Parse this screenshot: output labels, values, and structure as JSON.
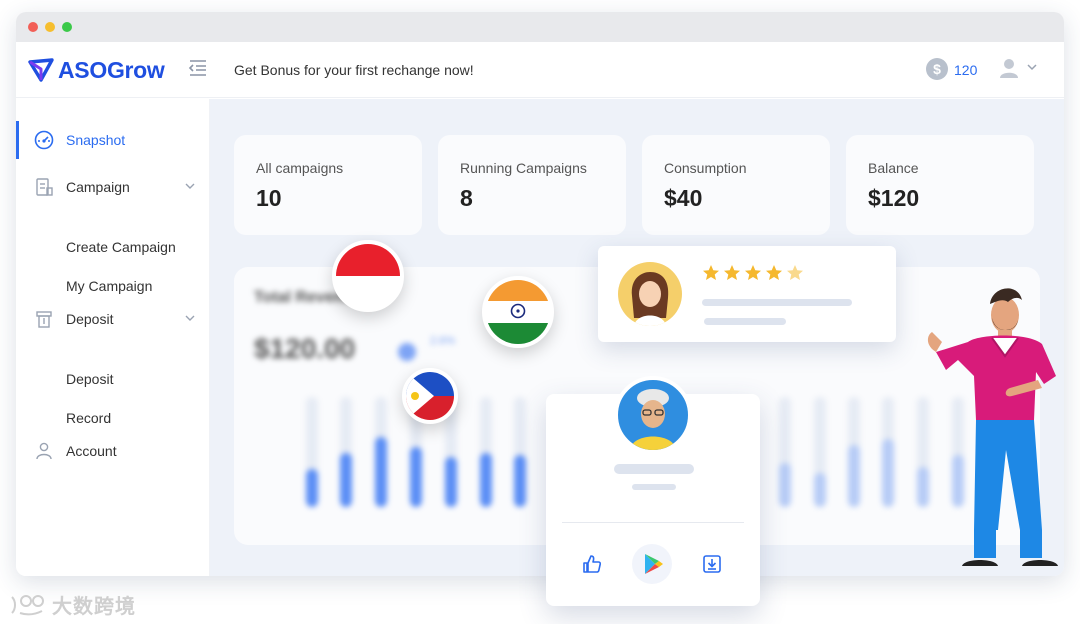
{
  "app": {
    "logo_text": "ASOGrow"
  },
  "header": {
    "bonus_text": "Get Bonus for your first rechange now!",
    "coin_symbol": "$",
    "balance": "120"
  },
  "sidebar": {
    "snapshot": "Snapshot",
    "campaign": "Campaign",
    "create_campaign": "Create Campaign",
    "my_campaign": "My Campaign",
    "deposit": "Deposit",
    "deposit_sub": "Deposit",
    "record": "Record",
    "account": "Account"
  },
  "stats": [
    {
      "title": "All campaigns",
      "value": "10"
    },
    {
      "title": "Running Campaigns",
      "value": "8"
    },
    {
      "title": "Consumption",
      "value": "$40"
    },
    {
      "title": "Balance",
      "value": "$120"
    }
  ],
  "revenue": {
    "title": "Total Revenue",
    "amount": "$120.00",
    "change": "2.6%"
  },
  "review": {
    "rating": 4.5,
    "max_rating": 5
  },
  "watermark": {
    "text": "大数跨境"
  },
  "colors": {
    "accent": "#2b6cf0",
    "star": "#f5b82e",
    "shirt": "#d81b7a",
    "pants": "#1e88e5"
  }
}
